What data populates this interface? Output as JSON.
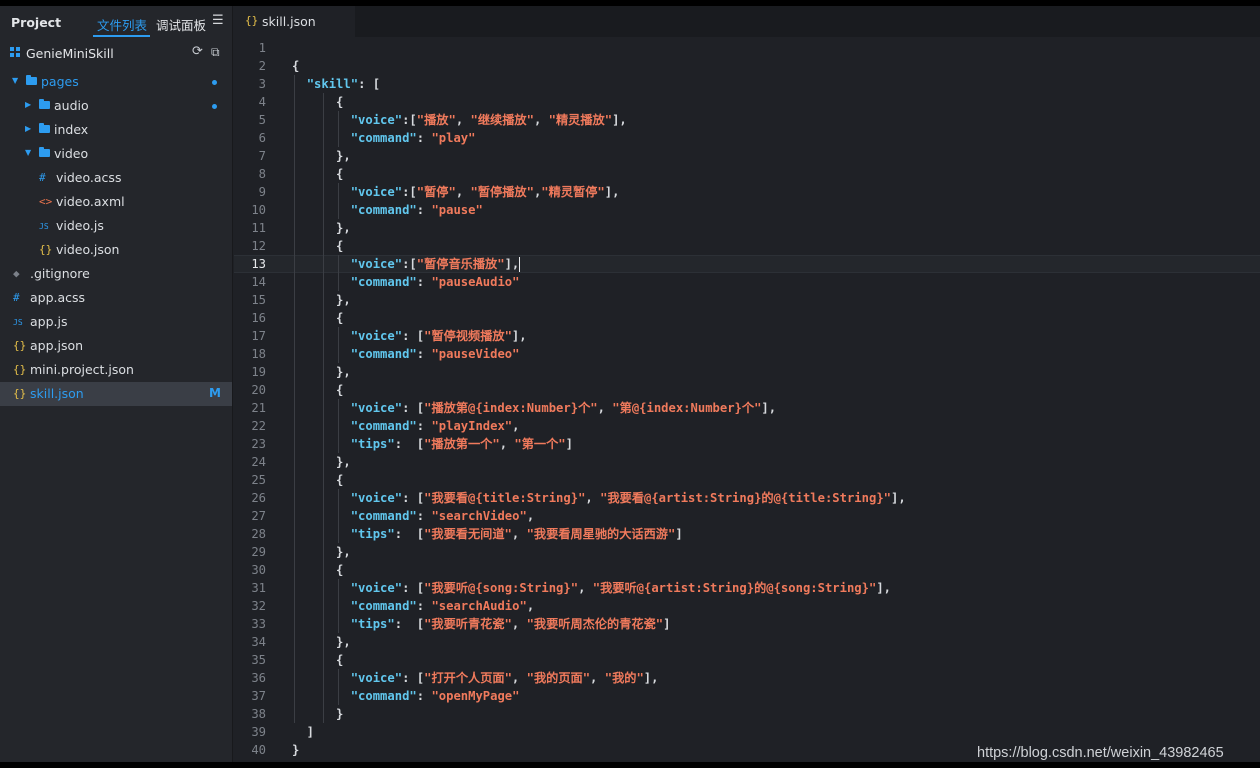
{
  "sidebar": {
    "header": {
      "project": "Project",
      "files_tab": "文件列表",
      "debug_tab": "调试面板",
      "menu_glyph": "☰"
    },
    "project_name": "GenieMiniSkill",
    "tree": [
      {
        "label": "pages",
        "kind": "folder",
        "depth": 0,
        "expanded": true,
        "modified_dot": true
      },
      {
        "label": "audio",
        "kind": "folder",
        "depth": 1,
        "expanded": false,
        "modified_dot": true
      },
      {
        "label": "index",
        "kind": "folder",
        "depth": 1,
        "expanded": false
      },
      {
        "label": "video",
        "kind": "folder",
        "depth": 1,
        "expanded": true
      },
      {
        "label": "video.acss",
        "kind": "acss",
        "depth": 2
      },
      {
        "label": "video.axml",
        "kind": "axml",
        "depth": 2
      },
      {
        "label": "video.js",
        "kind": "js",
        "depth": 2
      },
      {
        "label": "video.json",
        "kind": "json",
        "depth": 2
      },
      {
        "label": ".gitignore",
        "kind": "git",
        "depth": 0
      },
      {
        "label": "app.acss",
        "kind": "acss",
        "depth": 0
      },
      {
        "label": "app.js",
        "kind": "js",
        "depth": 0
      },
      {
        "label": "app.json",
        "kind": "json",
        "depth": 0
      },
      {
        "label": "mini.project.json",
        "kind": "json",
        "depth": 0
      },
      {
        "label": "skill.json",
        "kind": "json",
        "depth": 0,
        "selected": true,
        "badge": "M"
      }
    ]
  },
  "editor": {
    "tab_label": "skill.json",
    "current_line": 13,
    "lines": [
      "",
      "{",
      "  \"skill\": [",
      "      {",
      "        \"voice\":[\"播放\", \"继续播放\", \"精灵播放\"],",
      "        \"command\": \"play\"",
      "      },",
      "      {",
      "        \"voice\":[\"暂停\", \"暂停播放\",\"精灵暂停\"],",
      "        \"command\": \"pause\"",
      "      },",
      "      {",
      "        \"voice\":[\"暂停音乐播放\"],",
      "        \"command\": \"pauseAudio\"",
      "      },",
      "      {",
      "        \"voice\": [\"暂停视频播放\"],",
      "        \"command\": \"pauseVideo\"",
      "      },",
      "      {",
      "        \"voice\": [\"播放第@{index:Number}个\", \"第@{index:Number}个\"],",
      "        \"command\": \"playIndex\",",
      "        \"tips\":  [\"播放第一个\", \"第一个\"]",
      "      },",
      "      {",
      "        \"voice\": [\"我要看@{title:String}\", \"我要看@{artist:String}的@{title:String}\"],",
      "        \"command\": \"searchVideo\",",
      "        \"tips\":  [\"我要看无间道\", \"我要看周星驰的大话西游\"]",
      "      },",
      "      {",
      "        \"voice\": [\"我要听@{song:String}\", \"我要听@{artist:String}的@{song:String}\"],",
      "        \"command\": \"searchAudio\",",
      "        \"tips\":  [\"我要听青花瓷\", \"我要听周杰伦的青花瓷\"]",
      "      },",
      "      {",
      "        \"voice\": [\"打开个人页面\", \"我的页面\", \"我的\"],",
      "        \"command\": \"openMyPage\"",
      "      }",
      "  ]",
      "}"
    ]
  },
  "watermark": "https://blog.csdn.net/weixin_43982465",
  "colors": {
    "accent": "#2d9cf0",
    "key": "#61c7ee",
    "string": "#f07a5c",
    "json_icon": "#e6c04a"
  }
}
